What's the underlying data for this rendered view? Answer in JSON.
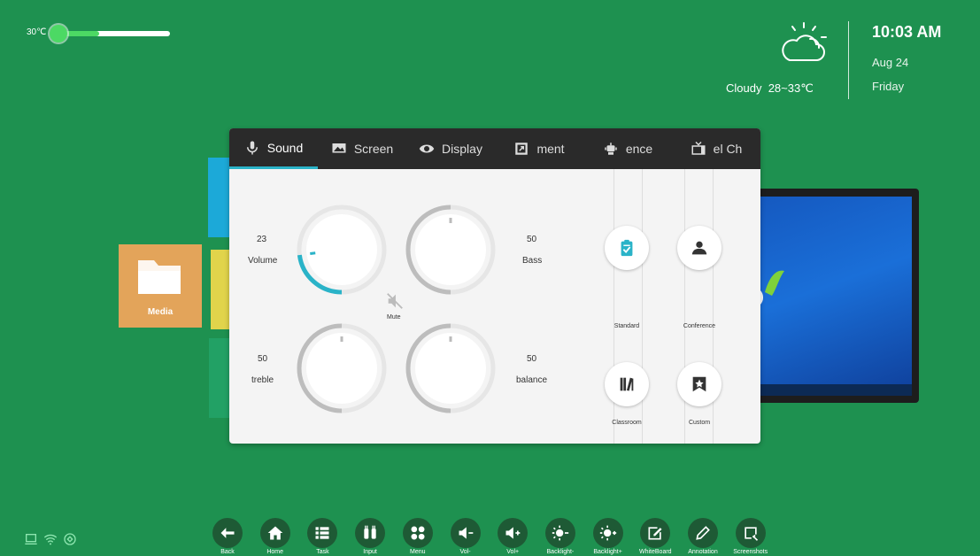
{
  "status": {
    "temperature_label": "30℃",
    "temperature_level": 0.4
  },
  "weather": {
    "condition": "Cloudy",
    "range": "28~33℃",
    "icon": "cloud-sun-icon"
  },
  "clock": {
    "time": "10:03 AM",
    "date": "Aug 24",
    "weekday": "Friday"
  },
  "tiles": {
    "media_label": "Media"
  },
  "dialog": {
    "tabs": [
      {
        "label": "Sound",
        "icon": "microphone-icon",
        "active": true
      },
      {
        "label": "Screen",
        "icon": "screen-icon"
      },
      {
        "label": "Display",
        "icon": "eye-icon"
      },
      {
        "label": "ment",
        "icon": "adjust-icon"
      },
      {
        "label": "ence",
        "icon": "robot-icon"
      },
      {
        "label": "el Ch",
        "icon": "tv-icon"
      }
    ],
    "volume": {
      "value": "23",
      "label": "Volume",
      "level": 0.23
    },
    "bass": {
      "value": "50",
      "label": "Bass",
      "level": 0.5
    },
    "treble": {
      "value": "50",
      "label": "treble",
      "level": 0.5
    },
    "balance": {
      "value": "50",
      "label": "balance",
      "level": 0.5
    },
    "mute_label": "Mute",
    "presets": [
      {
        "label": "Standard",
        "icon": "clipboard-check-icon"
      },
      {
        "label": "Conference",
        "icon": "people-icon"
      },
      {
        "label": "Classroom",
        "icon": "books-icon"
      },
      {
        "label": "Custom",
        "icon": "star-icon"
      }
    ]
  },
  "dock": [
    {
      "label": "Back",
      "icon": "back-arrow-icon"
    },
    {
      "label": "Home",
      "icon": "home-icon"
    },
    {
      "label": "Task",
      "icon": "task-list-icon"
    },
    {
      "label": "Input",
      "icon": "input-plug-icon"
    },
    {
      "label": "Menu",
      "icon": "menu-grid-icon"
    },
    {
      "label": "Vol-",
      "icon": "volume-down-icon"
    },
    {
      "label": "Vol+",
      "icon": "volume-up-icon"
    },
    {
      "label": "Backlight-",
      "icon": "backlight-down-icon"
    },
    {
      "label": "Backlight+",
      "icon": "backlight-up-icon"
    },
    {
      "label": "WhiteBoard",
      "icon": "whiteboard-icon"
    },
    {
      "label": "Annotation",
      "icon": "pen-icon"
    },
    {
      "label": "Screenshots",
      "icon": "screenshot-icon"
    }
  ],
  "colors": {
    "background": "#1e9150",
    "accent": "#2ab3c8",
    "slider": "#4cd964"
  }
}
